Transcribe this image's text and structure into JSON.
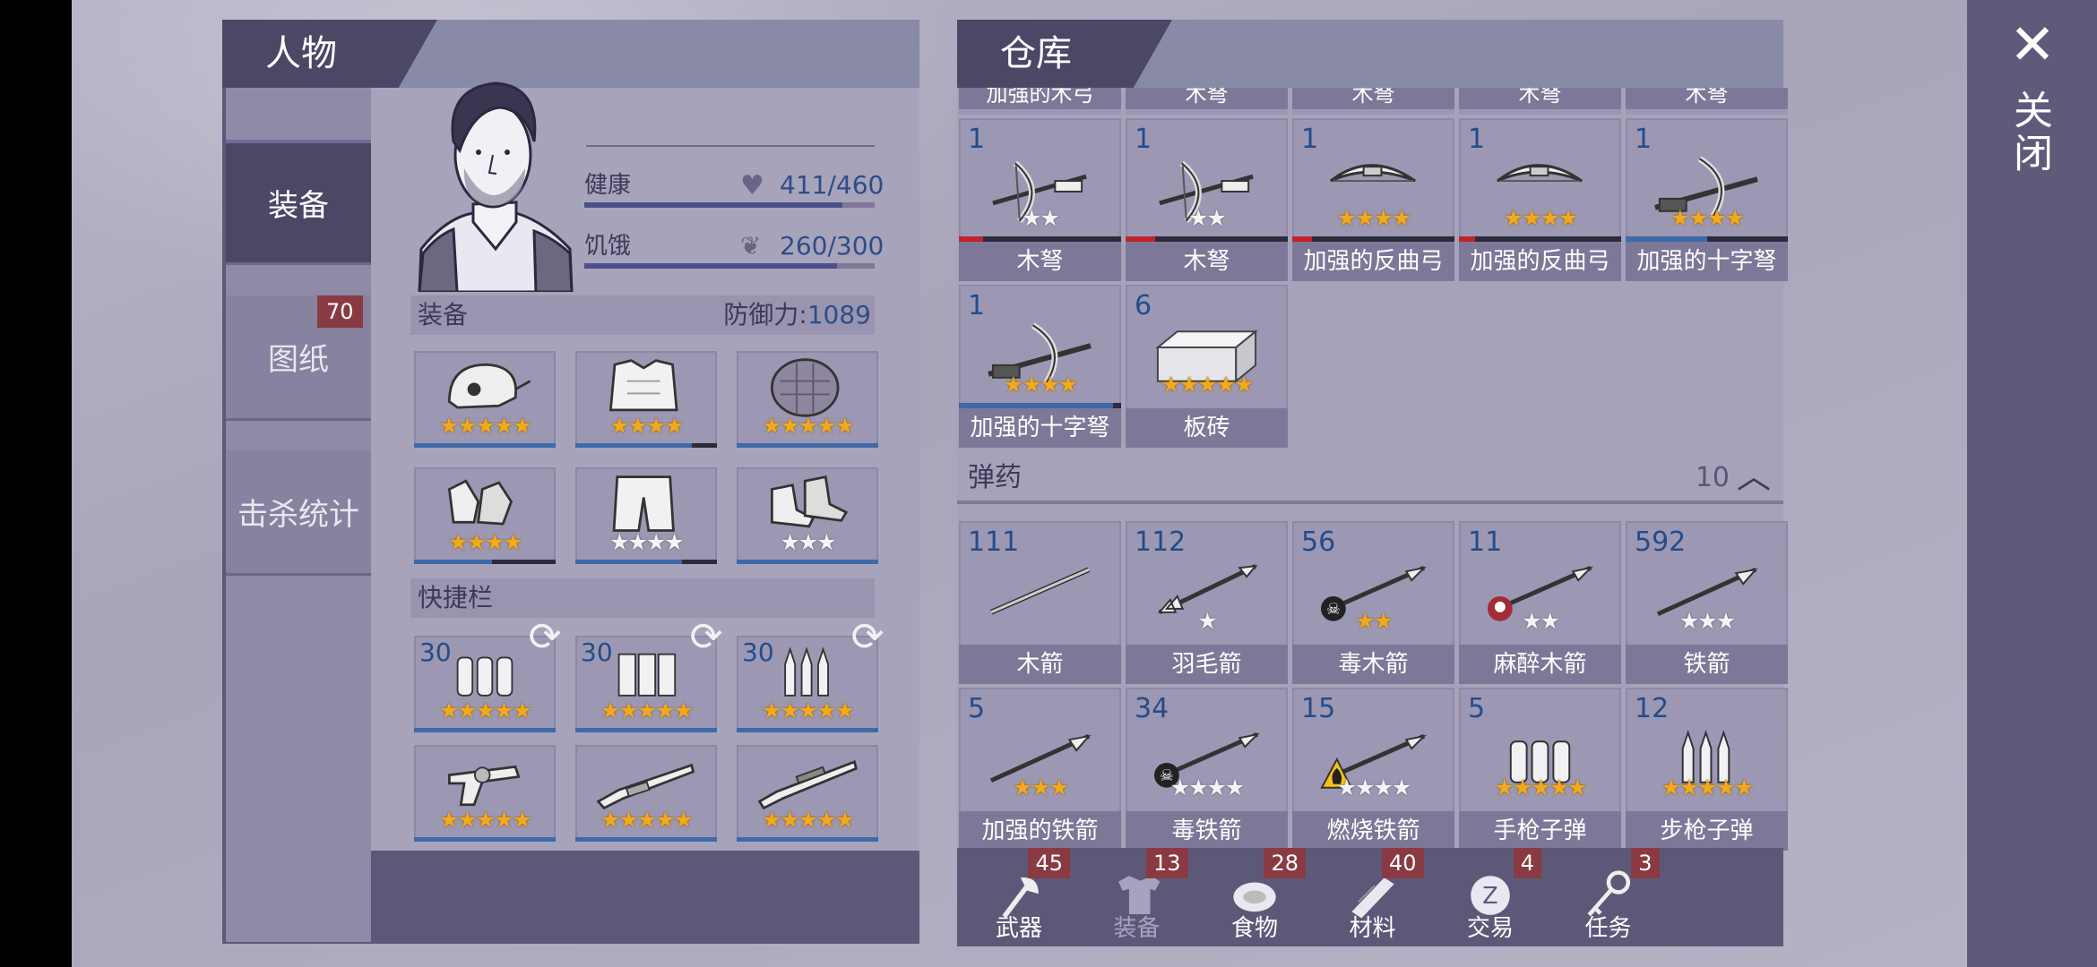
{
  "close": {
    "label": "关闭",
    "icon": "close-icon"
  },
  "character": {
    "header": "人物",
    "tabs": [
      {
        "label": "装备",
        "active": true
      },
      {
        "label": "图纸",
        "badge": "70"
      },
      {
        "label": "击杀统计"
      }
    ],
    "stats": {
      "health_label": "健康",
      "health_value": "411/460",
      "health_fraction": 0.89,
      "hunger_label": "饥饿",
      "hunger_value": "260/300",
      "hunger_fraction": 0.87
    },
    "equipment": {
      "title": "装备",
      "defense_label": "防御力:",
      "defense_value": "1089",
      "slots": [
        {
          "name": "helmet",
          "stars_gold": 5,
          "stars_white": 0,
          "durability": 1.0
        },
        {
          "name": "body-armor",
          "stars_gold": 4,
          "stars_white": 0,
          "durability": 0.82
        },
        {
          "name": "shield",
          "stars_gold": 5,
          "stars_white": 0,
          "durability": 1.0
        },
        {
          "name": "gloves",
          "stars_gold": 4,
          "stars_white": 0,
          "durability": 0.55
        },
        {
          "name": "pants",
          "stars_gold": 0,
          "stars_white": 4,
          "durability": 0.75
        },
        {
          "name": "boots",
          "stars_gold": 0,
          "stars_white": 3,
          "durability": 1.0
        }
      ]
    },
    "quickbar": {
      "title": "快捷栏",
      "slots": [
        {
          "name": "pistol-ammo",
          "count": "30",
          "stars_gold": 5,
          "stars_white": 0
        },
        {
          "name": "shotgun-shells",
          "count": "30",
          "stars_gold": 5,
          "stars_white": 0
        },
        {
          "name": "rifle-ammo",
          "count": "30",
          "stars_gold": 5,
          "stars_white": 0
        },
        {
          "name": "revolver",
          "count": "",
          "stars_gold": 5,
          "stars_white": 0
        },
        {
          "name": "shotgun",
          "count": "",
          "stars_gold": 5,
          "stars_white": 0
        },
        {
          "name": "rifle",
          "count": "",
          "stars_gold": 5,
          "stars_white": 0
        }
      ]
    }
  },
  "warehouse": {
    "header": "仓库",
    "top_strip": [
      "加强的木弓",
      "木弩",
      "木弩",
      "木弩",
      "木弩"
    ],
    "weapons": [
      {
        "label": "木弩",
        "count": "1",
        "stars_gold": 0,
        "stars_white": 2,
        "durability": 0.15,
        "dur_color": "#c0242a",
        "icon": "crossbow"
      },
      {
        "label": "木弩",
        "count": "1",
        "stars_gold": 0,
        "stars_white": 2,
        "durability": 0.18,
        "dur_color": "#c0242a",
        "icon": "crossbow"
      },
      {
        "label": "加强的反曲弓",
        "count": "1",
        "stars_gold": 4,
        "stars_white": 0,
        "durability": 0.12,
        "dur_color": "#c0242a",
        "icon": "bow"
      },
      {
        "label": "加强的反曲弓",
        "count": "1",
        "stars_gold": 4,
        "stars_white": 0,
        "durability": 0.1,
        "dur_color": "#c0242a",
        "icon": "bow"
      },
      {
        "label": "加强的十字弩",
        "count": "1",
        "stars_gold": 4,
        "stars_white": 0,
        "durability": 0.5,
        "dur_color": "#3d6aa8",
        "icon": "heavy-crossbow"
      },
      {
        "label": "加强的十字弩",
        "count": "1",
        "stars_gold": 4,
        "stars_white": 0,
        "durability": 0.95,
        "dur_color": "#3d6aa8",
        "icon": "heavy-crossbow"
      },
      {
        "label": "板砖",
        "count": "6",
        "stars_gold": 5,
        "stars_white": 0,
        "durability": null,
        "icon": "brick"
      }
    ],
    "ammo_title": "弹药",
    "ammo_count": "10",
    "ammo": [
      {
        "label": "木箭",
        "count": "111",
        "stars_gold": 0,
        "stars_white": 0,
        "icon": "arrow"
      },
      {
        "label": "羽毛箭",
        "count": "112",
        "stars_gold": 0,
        "stars_white": 1,
        "icon": "feather-arrow"
      },
      {
        "label": "毒木箭",
        "count": "56",
        "stars_gold": 2,
        "stars_white": 0,
        "icon": "poison-arrow"
      },
      {
        "label": "麻醉木箭",
        "count": "11",
        "stars_gold": 0,
        "stars_white": 2,
        "icon": "tranq-arrow"
      },
      {
        "label": "铁箭",
        "count": "592",
        "stars_gold": 0,
        "stars_white": 3,
        "icon": "iron-arrow"
      },
      {
        "label": "加强的铁箭",
        "count": "5",
        "stars_gold": 3,
        "stars_white": 0,
        "icon": "iron-arrow"
      },
      {
        "label": "毒铁箭",
        "count": "34",
        "stars_gold": 0,
        "stars_white": 4,
        "icon": "poison-arrow"
      },
      {
        "label": "燃烧铁箭",
        "count": "15",
        "stars_gold": 0,
        "stars_white": 4,
        "icon": "fire-arrow"
      },
      {
        "label": "手枪子弹",
        "count": "5",
        "stars_gold": 5,
        "stars_white": 0,
        "icon": "pistol-ammo"
      },
      {
        "label": "步枪子弹",
        "count": "12",
        "stars_gold": 5,
        "stars_white": 0,
        "icon": "rifle-ammo"
      }
    ],
    "bottom_tabs": [
      {
        "label": "武器",
        "badge": "45",
        "icon": "axe-icon",
        "active": true
      },
      {
        "label": "装备",
        "badge": "13",
        "icon": "shirt-icon",
        "active": false
      },
      {
        "label": "食物",
        "badge": "28",
        "icon": "meat-icon",
        "active": true
      },
      {
        "label": "材料",
        "badge": "40",
        "icon": "wood-icon",
        "active": true
      },
      {
        "label": "交易",
        "badge": "4",
        "icon": "coin-icon",
        "active": true
      },
      {
        "label": "任务",
        "badge": "3",
        "icon": "key-icon",
        "active": true
      }
    ]
  }
}
